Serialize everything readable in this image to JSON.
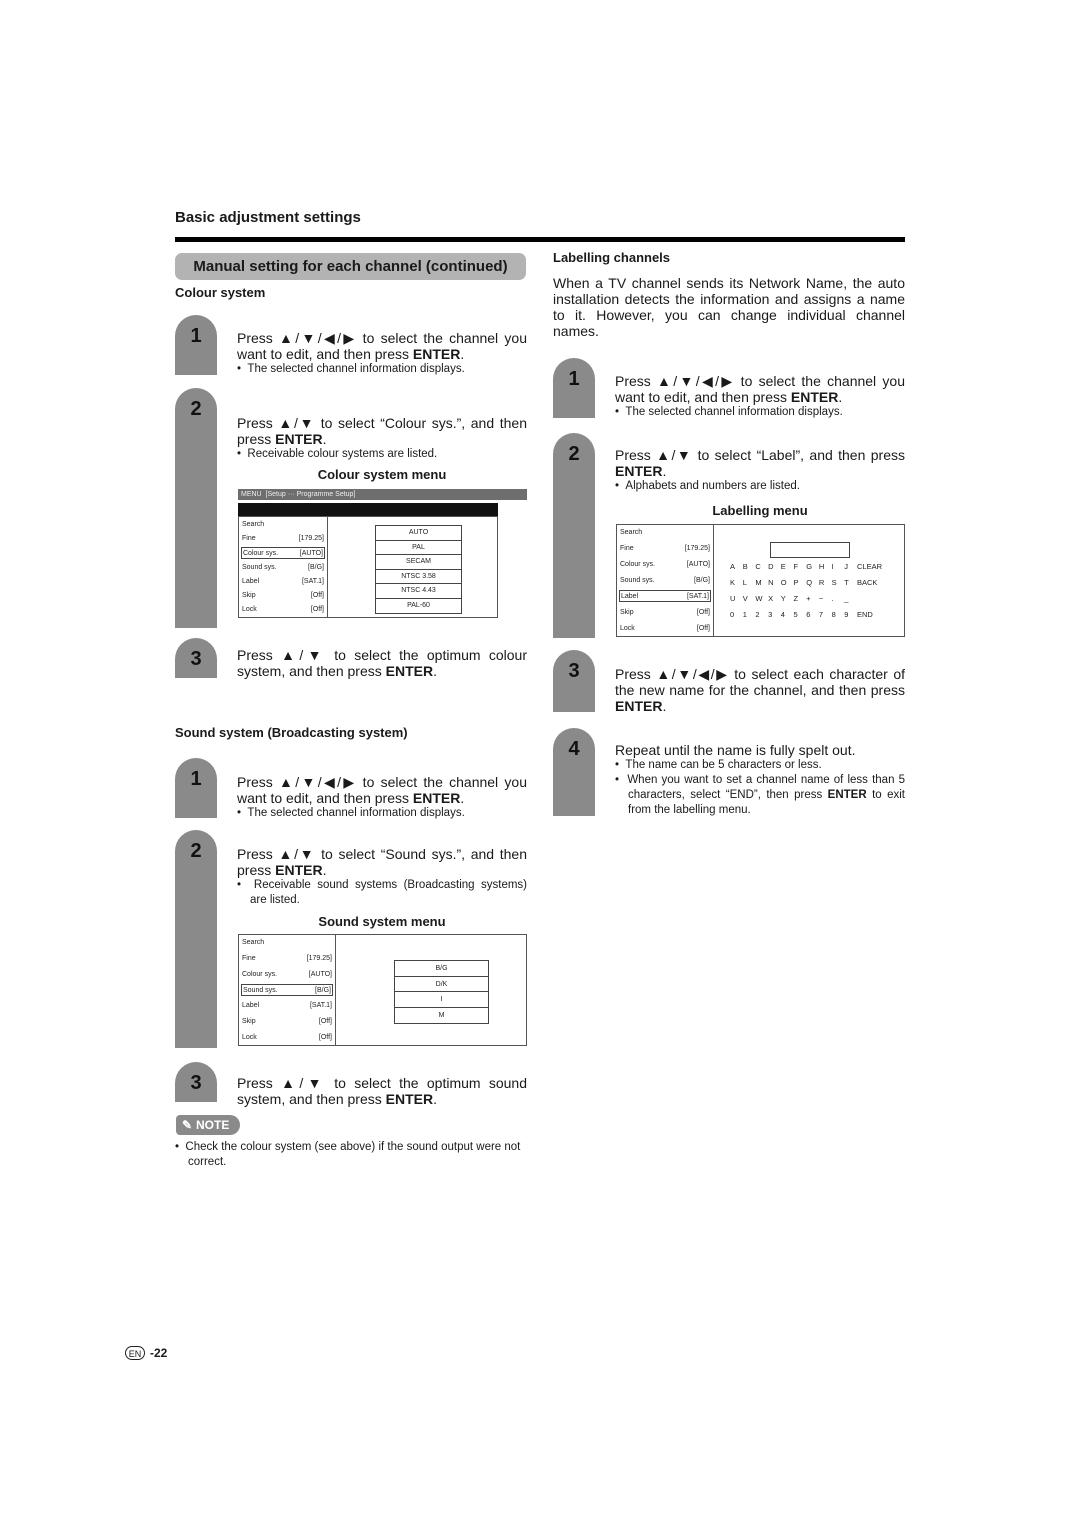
{
  "page": {
    "section_title": "Basic adjustment settings",
    "banner": "Manual setting for each channel (continued)",
    "page_lang": "EN",
    "page_number": "-22"
  },
  "colour_system": {
    "heading": "Colour system",
    "steps": [
      {
        "num": "1",
        "text_pre": "Press ▲/▼/◀/▶ to select the channel you want to edit, and then press ",
        "bold": "ENTER",
        "text_post": ".",
        "bullets": [
          "The selected channel information displays."
        ]
      },
      {
        "num": "2",
        "text_pre": "Press ▲/▼ to select “Colour sys.”, and then press ",
        "bold": "ENTER",
        "text_post": ".",
        "bullets": [
          "Receivable colour systems are listed."
        ]
      },
      {
        "num": "3",
        "text_pre": "Press ▲/▼ to select the optimum colour system, and then press ",
        "bold": "ENTER",
        "text_post": ".",
        "bullets": []
      }
    ],
    "menu_title": "Colour system menu",
    "menu_header": "MENU",
    "menu_breadcrumb": "[Setup ··· Programme Setup]",
    "options": [
      "AUTO",
      "PAL",
      "SECAM",
      "NTSC 3.58",
      "NTSC 4.43",
      "PAL-60"
    ]
  },
  "sound_system": {
    "heading": "Sound system (Broadcasting system)",
    "steps": [
      {
        "num": "1",
        "text_pre": "Press ▲/▼/◀/▶ to select the channel you want to edit, and then press ",
        "bold": "ENTER",
        "text_post": ".",
        "bullets": [
          "The selected channel information displays."
        ]
      },
      {
        "num": "2",
        "text_pre": "Press ▲/▼ to select “Sound sys.”, and then press ",
        "bold": "ENTER",
        "text_post": ".",
        "bullets": [
          "Receivable sound systems (Broadcasting systems) are listed."
        ]
      },
      {
        "num": "3",
        "text_pre": "Press ▲/▼ to select the optimum sound system, and then press ",
        "bold": "ENTER",
        "text_post": ".",
        "bullets": []
      }
    ],
    "menu_title": "Sound system menu",
    "options": [
      "B/G",
      "D/K",
      "I",
      "M"
    ]
  },
  "note": {
    "label": "NOTE",
    "items": [
      "Check the colour system (see above) if the sound output were not correct."
    ]
  },
  "channel_settings": [
    {
      "key": "Search",
      "value": ""
    },
    {
      "key": "Fine",
      "value": "[179.25]"
    },
    {
      "key": "Colour sys.",
      "value": "[AUTO]"
    },
    {
      "key": "Sound sys.",
      "value": "[B/G]"
    },
    {
      "key": "Label",
      "value": "[SAT.1]"
    },
    {
      "key": "Skip",
      "value": "[Off]"
    },
    {
      "key": "Lock",
      "value": "[Off]"
    }
  ],
  "labelling": {
    "heading": "Labelling channels",
    "intro": "When a TV channel sends its Network Name, the auto installation detects the information and assigns a name to it. However, you can change individual channel names.",
    "steps": [
      {
        "num": "1",
        "text_pre": "Press ▲/▼/◀/▶ to select the channel you want to edit, and then press ",
        "bold": "ENTER",
        "text_post": ".",
        "bullets": [
          "The selected channel information displays."
        ]
      },
      {
        "num": "2",
        "text_pre": "Press ▲/▼ to select “Label”, and then press ",
        "bold": "ENTER",
        "text_post": ".",
        "bullets": [
          "Alphabets and numbers are listed."
        ]
      },
      {
        "num": "3",
        "text_pre": "Press ▲/▼/◀/▶ to select each character of the new name for the channel, and then press ",
        "bold": "ENTER",
        "text_post": ".",
        "bullets": []
      },
      {
        "num": "4",
        "text_pre": "Repeat until the name is fully spelt out.",
        "bold": "",
        "text_post": "",
        "bullets": [
          "The name can be 5 characters or less.",
          "When you want to set a channel name of less than 5 characters, select “END”, then press ENTER to exit from the labelling menu."
        ]
      }
    ],
    "menu_title": "Labelling menu",
    "char_rows": [
      [
        "A",
        "B",
        "C",
        "D",
        "E",
        "F",
        "G",
        "H",
        "I",
        "J",
        "CLEAR"
      ],
      [
        "K",
        "L",
        "M",
        "N",
        "O",
        "P",
        "Q",
        "R",
        "S",
        "T",
        "BACK"
      ],
      [
        "U",
        "V",
        "W",
        "X",
        "Y",
        "Z",
        "+",
        "−",
        ".",
        "_",
        ""
      ],
      [
        "0",
        "1",
        "2",
        "3",
        "4",
        "5",
        "6",
        "7",
        "8",
        "9",
        "END"
      ]
    ]
  }
}
